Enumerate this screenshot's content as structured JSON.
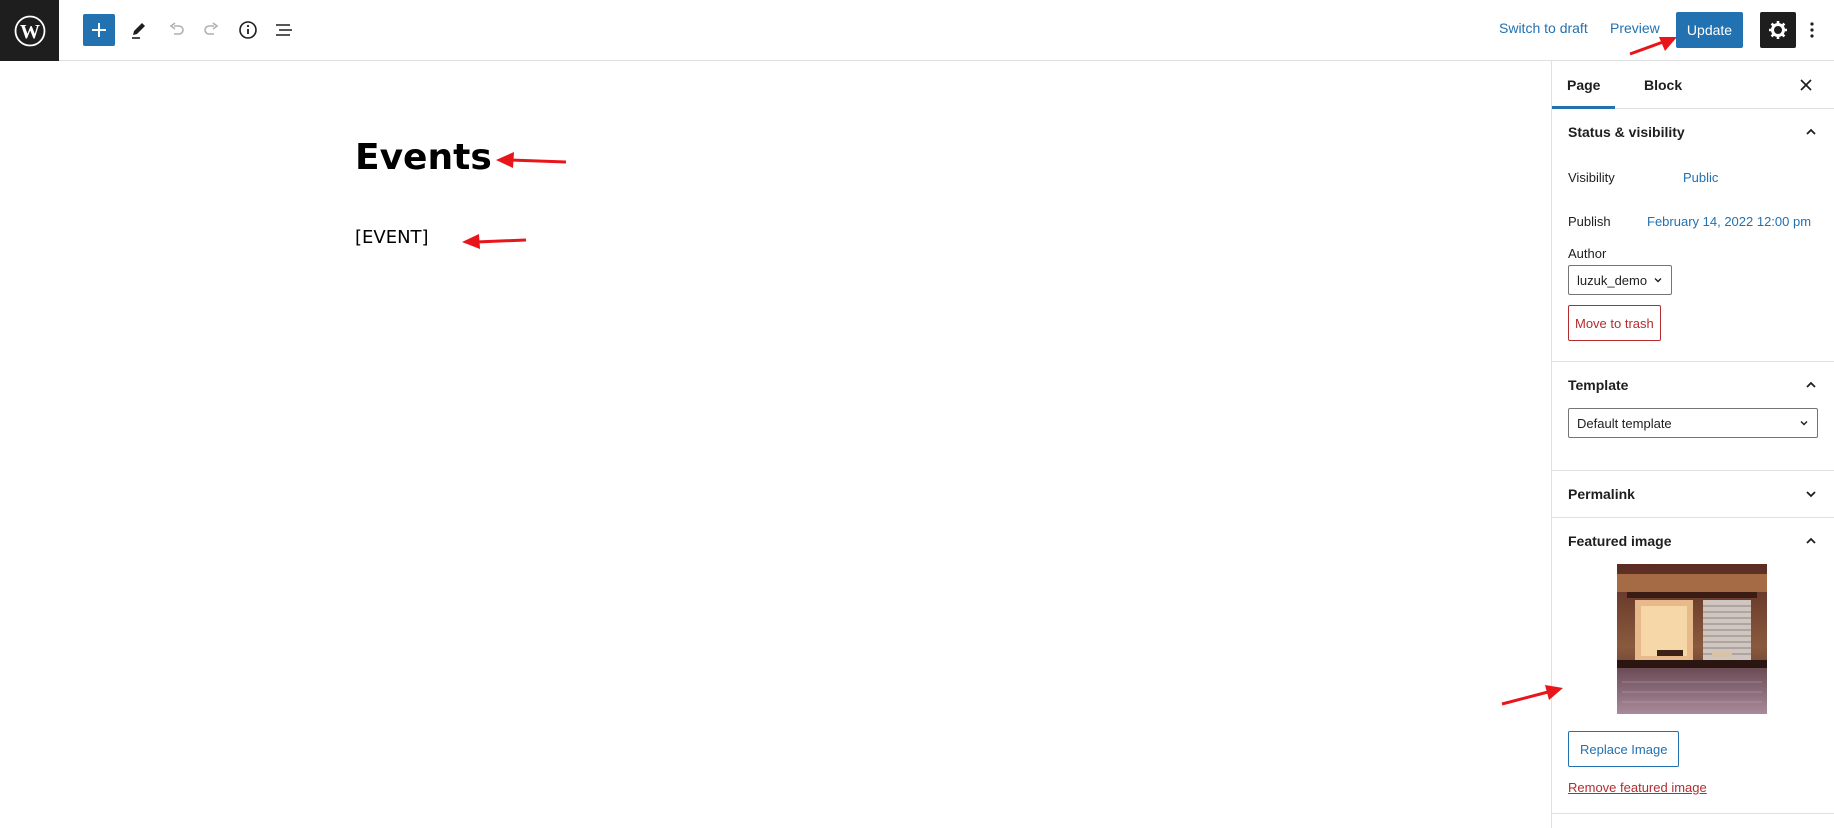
{
  "toolbar": {
    "add_icon": "plus-icon",
    "tools_icon": "pencil-icon",
    "undo_icon": "undo-icon",
    "redo_icon": "redo-icon",
    "details_icon": "info-icon",
    "outline_icon": "list-view-icon",
    "switch_to_draft": "Switch to draft",
    "preview": "Preview",
    "update": "Update",
    "settings_icon": "gear-icon",
    "more_icon": "kebab-icon"
  },
  "editor": {
    "title": "Events",
    "shortcode": "[EVENT]"
  },
  "sidebar": {
    "tabs": [
      {
        "label": "Page",
        "active": true
      },
      {
        "label": "Block",
        "active": false
      }
    ],
    "status": {
      "heading": "Status & visibility",
      "visibility_label": "Visibility",
      "visibility_value": "Public",
      "publish_label": "Publish",
      "publish_value": "February 14, 2022 12:00 pm",
      "author_label": "Author",
      "author_value": "luzuk_demo",
      "trash_label": "Move to trash"
    },
    "template": {
      "heading": "Template",
      "value": "Default template"
    },
    "permalink": {
      "heading": "Permalink"
    },
    "featured_image": {
      "heading": "Featured image",
      "replace_label": "Replace Image",
      "remove_label": "Remove featured image"
    }
  },
  "colors": {
    "accent": "#2271b1",
    "danger": "#b32d2e",
    "dark": "#1e1e1e",
    "annotation": "#e8161b"
  }
}
